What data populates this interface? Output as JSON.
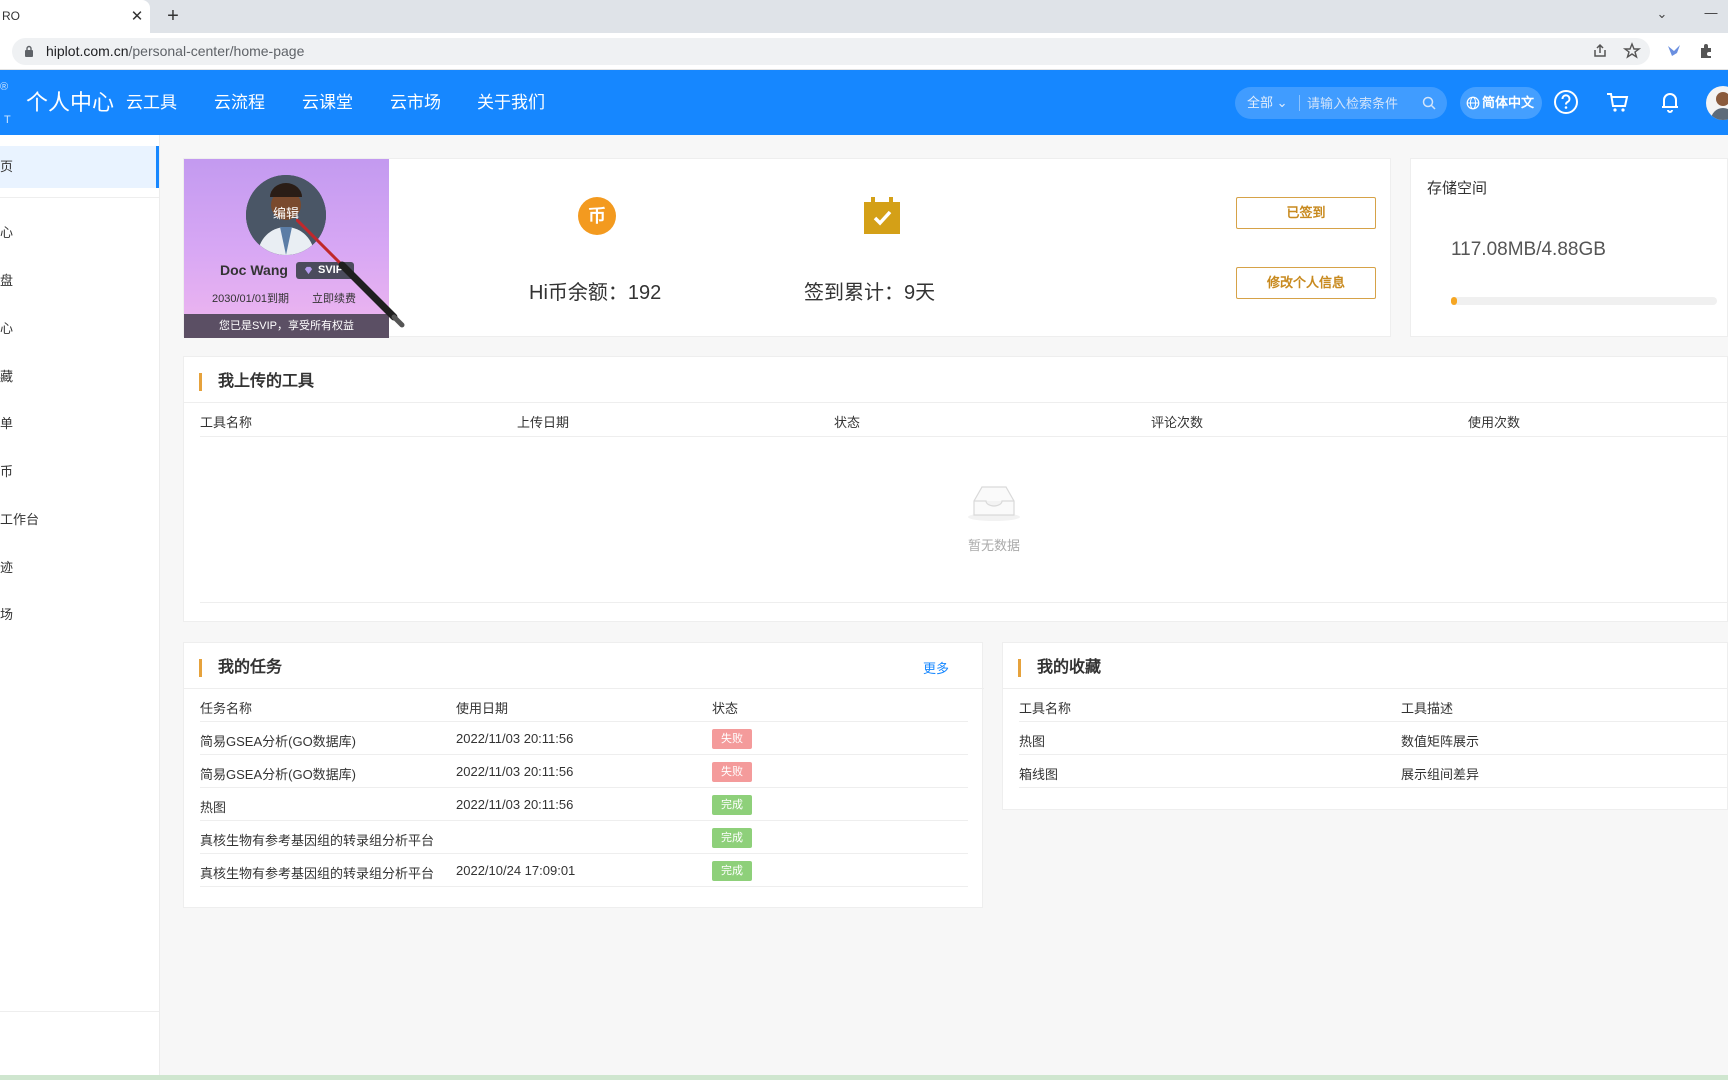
{
  "browser": {
    "tab_title": "RO",
    "tab_close": "✕",
    "new_tab": "+",
    "tab_menu": "⌄",
    "minimize": "—",
    "url_host": "hiplot.com.cn",
    "url_path": "/personal-center/home-page",
    "icons": [
      "lock-icon",
      "share-icon",
      "star-icon",
      "extension-bird-icon",
      "puzzle-icon"
    ]
  },
  "header": {
    "logo_mark_top": "®",
    "logo_mark_bottom": "T",
    "title": "个人中心",
    "nav": [
      "云工具",
      "云流程",
      "云课堂",
      "云市场",
      "关于我们"
    ],
    "search_scope": "全部",
    "search_placeholder": "请输入检索条件",
    "language": "简体中文",
    "accent_color": "#1687ff"
  },
  "sidebar": {
    "items": [
      "页",
      "心",
      "盘",
      "心",
      "藏",
      "单",
      "币",
      "工作台",
      "迹",
      "场"
    ]
  },
  "profile": {
    "edit_label": "编辑",
    "name": "Doc Wang",
    "badge": "SVIP",
    "expire": "2030/01/01到期",
    "renew": "立即续费",
    "svip_notice": "您已是SVIP，享受所有权益",
    "coin_icon_text": "币",
    "coin_label": "Hi币余额：192",
    "checkin_label": "签到累计：9天",
    "checked_in_button": "已签到",
    "edit_profile_button": "修改个人信息"
  },
  "storage": {
    "title": "存储空间",
    "value": "117.08MB/4.88GB",
    "used_fraction": 0.023
  },
  "my_tools": {
    "title": "我上传的工具",
    "columns": [
      "工具名称",
      "上传日期",
      "状态",
      "评论次数",
      "使用次数"
    ],
    "empty_text": "暂无数据"
  },
  "my_tasks": {
    "title": "我的任务",
    "more": "更多",
    "columns": [
      "任务名称",
      "使用日期",
      "状态"
    ],
    "rows": [
      {
        "name": "简易GSEA分析(GO数据库)",
        "date": "2022/11/03 20:11:56",
        "status": "失败"
      },
      {
        "name": "简易GSEA分析(GO数据库)",
        "date": "2022/11/03 20:11:56",
        "status": "失败"
      },
      {
        "name": "热图",
        "date": "2022/11/03 20:11:56",
        "status": "完成"
      },
      {
        "name": "真核生物有参考基因组的转录组分析平台",
        "date": "",
        "status": "完成"
      },
      {
        "name": "真核生物有参考基因组的转录组分析平台",
        "date": "2022/10/24 17:09:01",
        "status": "完成"
      }
    ]
  },
  "favorites": {
    "title": "我的收藏",
    "columns": [
      "工具名称",
      "工具描述"
    ],
    "rows": [
      {
        "name": "热图",
        "desc": "数值矩阵展示"
      },
      {
        "name": "箱线图",
        "desc": "展示组间差异"
      }
    ]
  },
  "colors": {
    "fail": "#f49b9b",
    "done": "#8ed07a",
    "gold": "#d6a248",
    "storage_fill": "#f5a623"
  }
}
